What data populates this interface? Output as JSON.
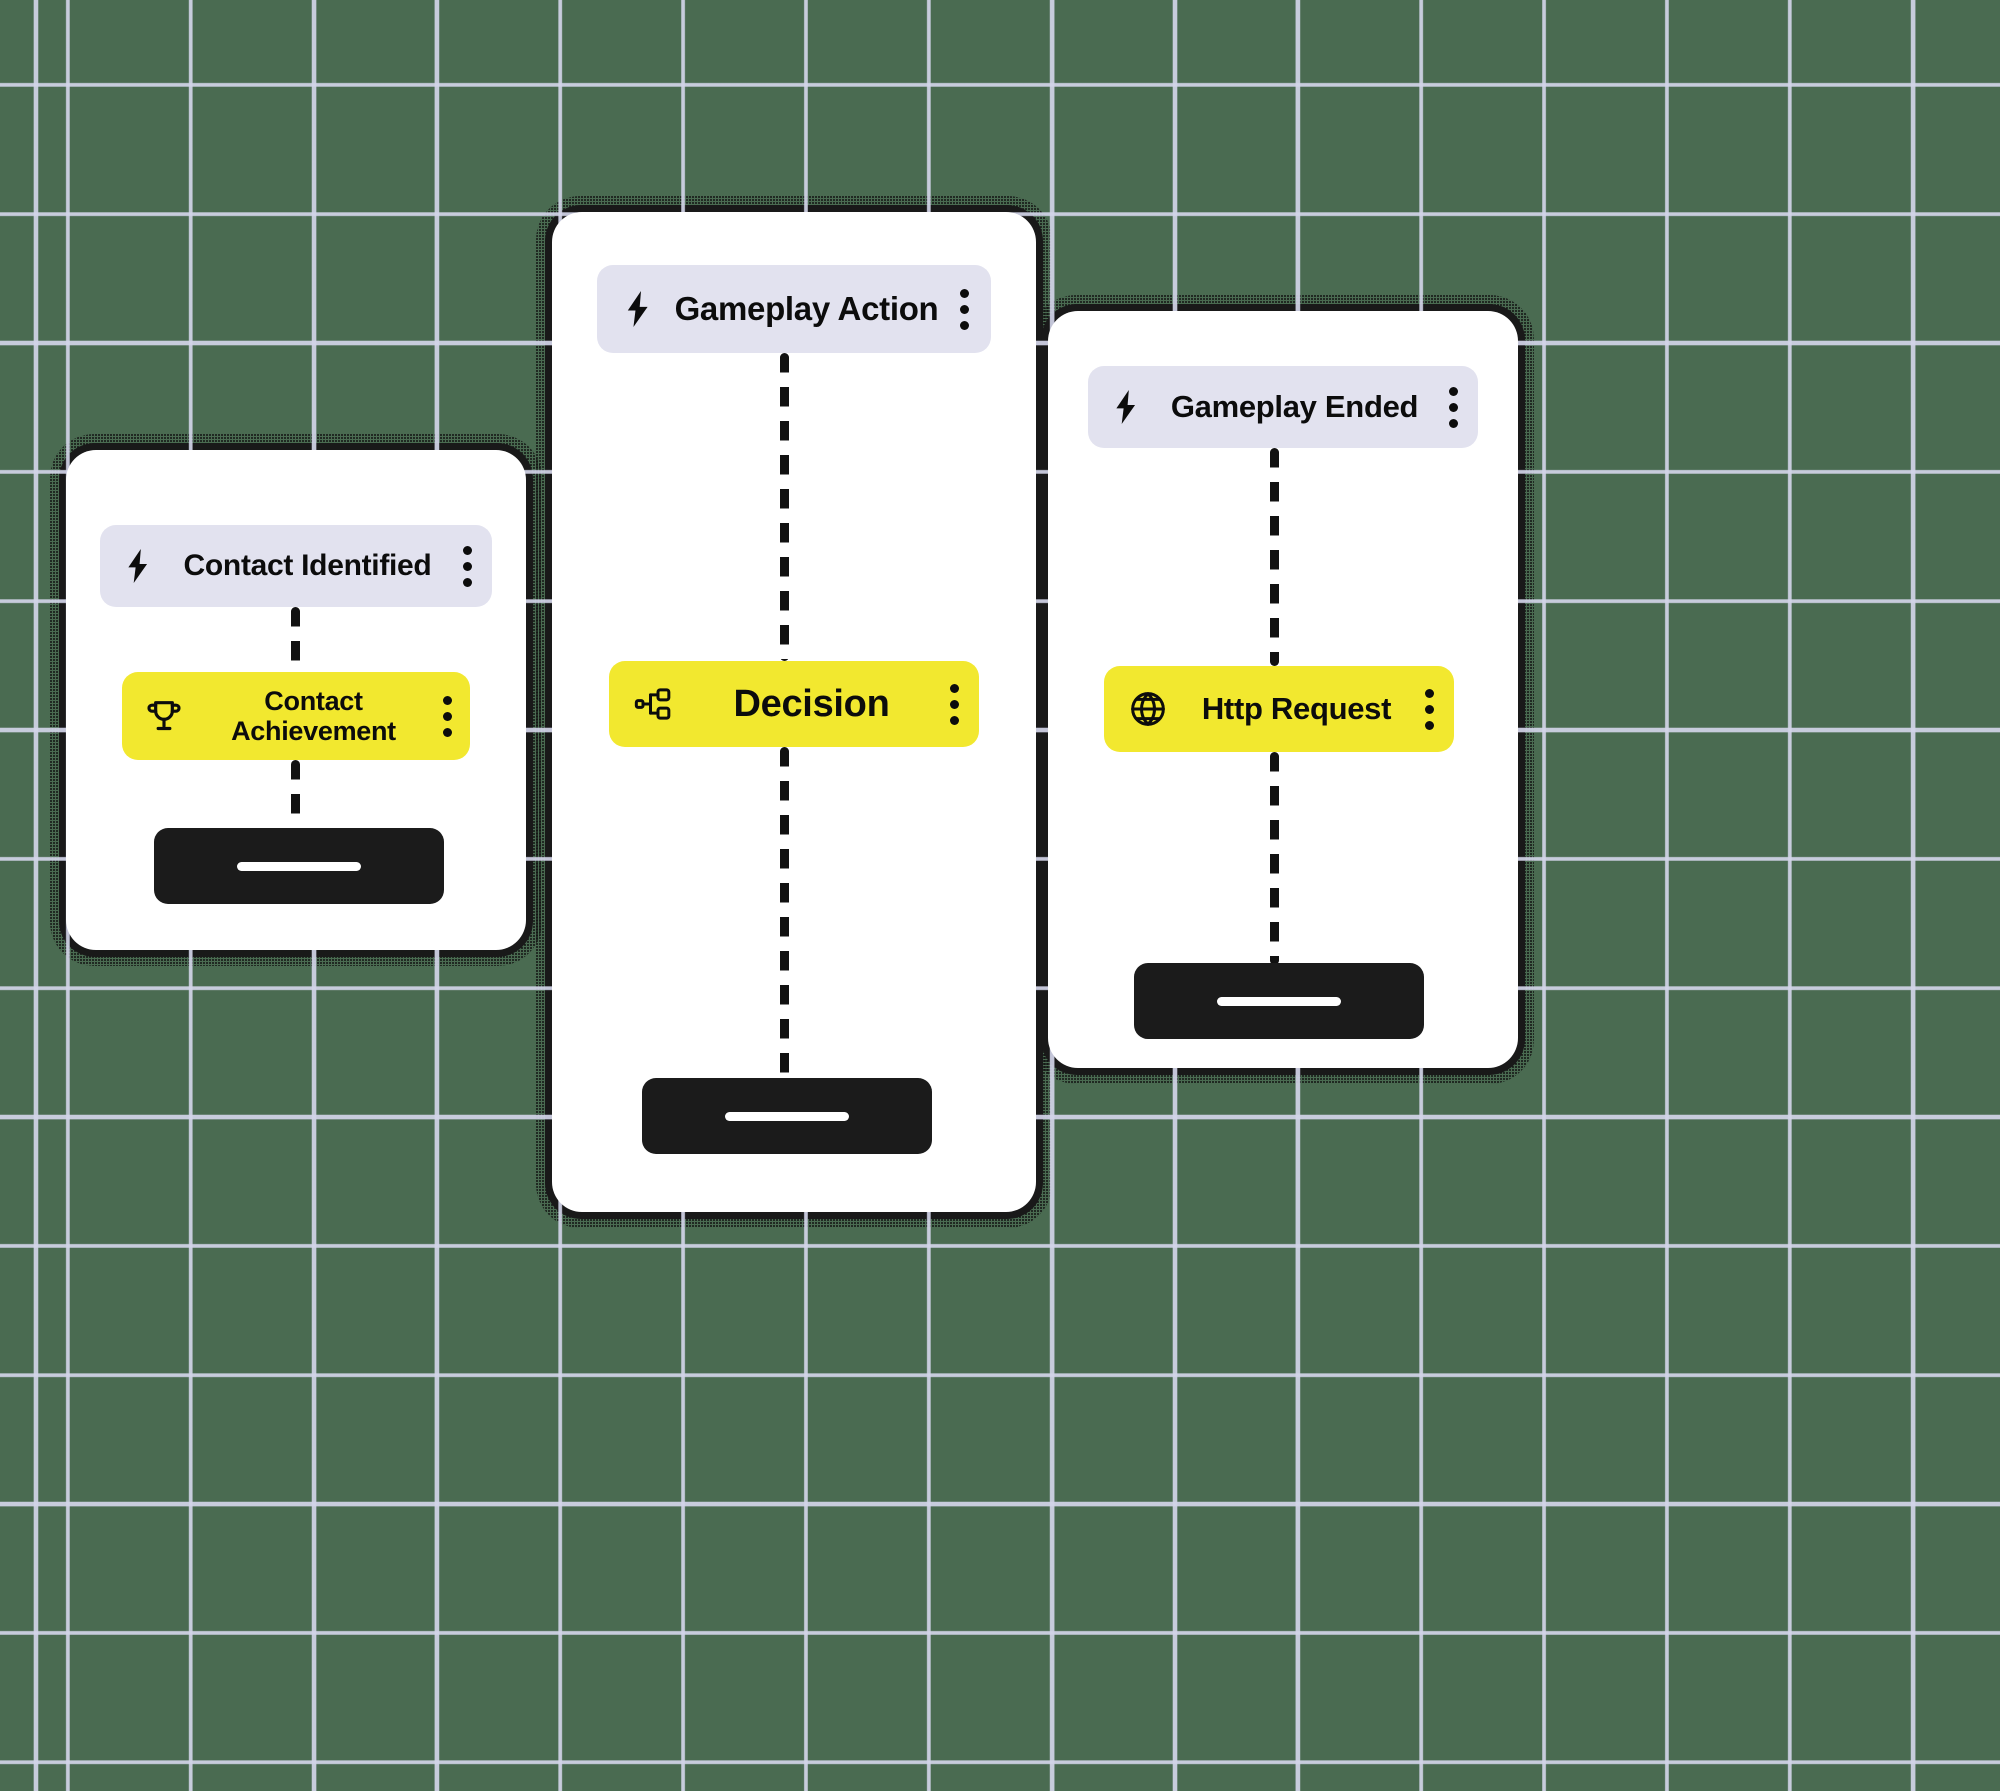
{
  "theme": {
    "background_color": "#4a6b51",
    "grid_line_color": "#d2d4e8",
    "card_color": "#ffffff",
    "trigger_pill_color": "#e2e2ef",
    "action_pill_color": "#f2e82f",
    "text_color": "#0c0c0c",
    "skeleton_color": "#1b1b1b",
    "connector_color": "#111111"
  },
  "cards": [
    {
      "name": "contact-workflow",
      "nodes": [
        {
          "label": "Contact Identified",
          "icon": "lightning-bolt-icon",
          "type": "trigger",
          "menu": "kebab-menu-icon"
        },
        {
          "label": "Contact\nAchievement",
          "icon": "trophy-icon",
          "type": "action",
          "menu": "kebab-menu-icon"
        }
      ],
      "placeholder": "skeleton-block"
    },
    {
      "name": "gameplay-action-workflow",
      "nodes": [
        {
          "label": "Gameplay Action",
          "icon": "lightning-bolt-icon",
          "type": "trigger",
          "menu": "kebab-menu-icon"
        },
        {
          "label": "Decision",
          "icon": "decision-branch-icon",
          "type": "action",
          "menu": "kebab-menu-icon"
        }
      ],
      "placeholder": "skeleton-block"
    },
    {
      "name": "gameplay-ended-workflow",
      "nodes": [
        {
          "label": "Gameplay Ended",
          "icon": "lightning-bolt-icon",
          "type": "trigger",
          "menu": "kebab-menu-icon"
        },
        {
          "label": "Http Request",
          "icon": "globe-icon",
          "type": "action",
          "menu": "kebab-menu-icon"
        }
      ],
      "placeholder": "skeleton-block"
    }
  ]
}
